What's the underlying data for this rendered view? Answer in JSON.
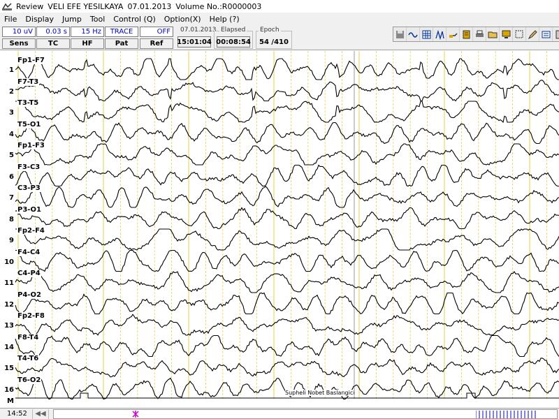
{
  "window": {
    "app_name": "Review",
    "patient_name": "VELI EFE YESILKAYA",
    "date": "07.01.2013",
    "volume": "Volume No.:R0000003"
  },
  "menu": [
    "File",
    "Display",
    "Jump",
    "Tool",
    "Control (Q)",
    "Option(X)",
    "Help (?)"
  ],
  "params": [
    {
      "value": "10 uV",
      "label": "Sens"
    },
    {
      "value": "0.03 s",
      "label": "TC"
    },
    {
      "value": "15 Hz",
      "label": "HF"
    },
    {
      "value": "TRACE",
      "label": "Pat"
    },
    {
      "value": "OFF",
      "label": "Ref"
    }
  ],
  "info": {
    "date": "07.01.2013",
    "clock": "15:01:04",
    "elapsed_label": "Elapsed",
    "elapsed": "00:08:54",
    "epoch_label": "Epoch",
    "epoch": "54 /410"
  },
  "tool_icons": [
    "save-icon",
    "wave-icon",
    "grid-icon",
    "montage-icon",
    "hand-icon",
    "book-icon",
    "print-icon",
    "folder-icon",
    "monitor-icon",
    "select-icon",
    "pencil-icon",
    "measure-icon",
    "exit-icon"
  ],
  "channels": [
    {
      "num": "1",
      "label": "Fp1-F7"
    },
    {
      "num": "2",
      "label": "F7-T3"
    },
    {
      "num": "3",
      "label": "T3-T5"
    },
    {
      "num": "4",
      "label": "T5-O1"
    },
    {
      "num": "5",
      "label": "Fp1-F3"
    },
    {
      "num": "6",
      "label": "F3-C3"
    },
    {
      "num": "7",
      "label": "C3-P3"
    },
    {
      "num": "8",
      "label": "P3-O1"
    },
    {
      "num": "9",
      "label": "Fp2-F4"
    },
    {
      "num": "10",
      "label": "F4-C4"
    },
    {
      "num": "11",
      "label": "C4-P4"
    },
    {
      "num": "12",
      "label": "P4-O2"
    },
    {
      "num": "13",
      "label": "Fp2-F8"
    },
    {
      "num": "14",
      "label": "F8-T4"
    },
    {
      "num": "15",
      "label": "T4-T6"
    },
    {
      "num": "16",
      "label": "T6-O2"
    }
  ],
  "marker_label": "M",
  "annotation": "Supheli Nobet Baslangici",
  "status": {
    "time": "14:52",
    "scroll_left": "◀◀"
  },
  "colors": {
    "gridline": "#e6d24a",
    "trace": "#000000",
    "param_value": "#0000cc",
    "timeline_marker": "#cc00cc",
    "epoch_ticks": "#0000cc"
  }
}
